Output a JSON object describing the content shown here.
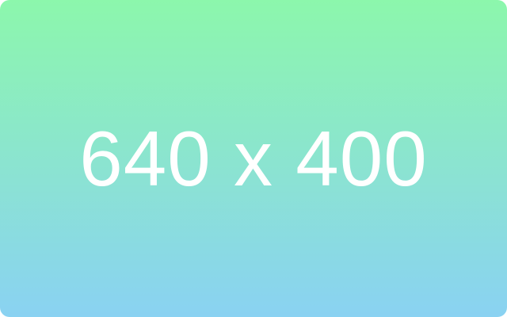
{
  "placeholder": {
    "label": "640 x 400",
    "colors": {
      "gradient_top": "#8cf7ac",
      "gradient_bottom": "#8ad2f2",
      "text": "#ffffff"
    }
  }
}
